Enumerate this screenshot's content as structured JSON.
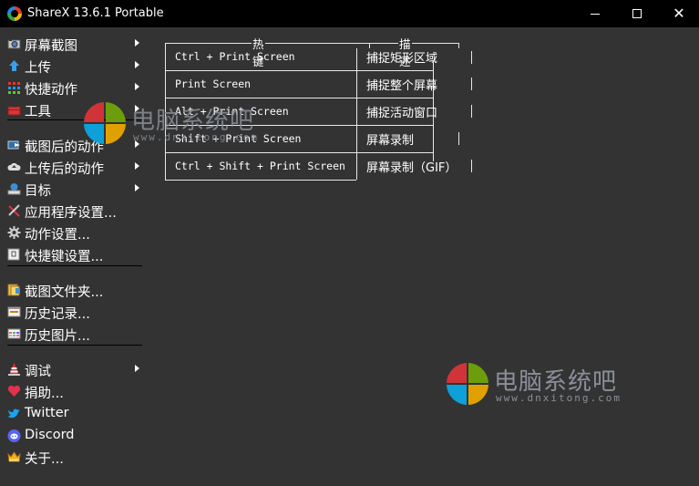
{
  "window": {
    "title": "ShareX 13.6.1 Portable",
    "minimize_icon": "minimize-icon",
    "maximize_icon": "maximize-icon",
    "close_icon": "close-icon"
  },
  "menu": {
    "items": [
      {
        "label": "屏幕截图",
        "icon": "camera-icon",
        "submenu": true
      },
      {
        "label": "上传",
        "icon": "upload-arrow-icon",
        "submenu": true
      },
      {
        "label": "快捷动作",
        "icon": "grid-dots-icon",
        "submenu": true
      },
      {
        "label": "工具",
        "icon": "toolbox-icon",
        "submenu": true
      },
      {
        "label": "截图后的动作",
        "icon": "after-capture-icon",
        "submenu": true
      },
      {
        "label": "上传后的动作",
        "icon": "cloud-upload-icon",
        "submenu": true
      },
      {
        "label": "目标",
        "icon": "destination-icon",
        "submenu": true
      },
      {
        "label": "应用程序设置...",
        "icon": "tools-icon",
        "submenu": false
      },
      {
        "label": "动作设置...",
        "icon": "gear-icon",
        "submenu": false
      },
      {
        "label": "快捷键设置...",
        "icon": "keyboard-key-icon",
        "submenu": false
      },
      {
        "label": "截图文件夹...",
        "icon": "folder-icon",
        "submenu": false
      },
      {
        "label": "历史记录...",
        "icon": "history-icon",
        "submenu": false
      },
      {
        "label": "历史图片...",
        "icon": "image-history-icon",
        "submenu": false
      },
      {
        "label": "调试",
        "icon": "traffic-cone-icon",
        "submenu": true
      },
      {
        "label": "捐助...",
        "icon": "heart-icon",
        "submenu": false
      },
      {
        "label": "Twitter",
        "icon": "twitter-icon",
        "submenu": false
      },
      {
        "label": "Discord",
        "icon": "discord-icon",
        "submenu": false
      },
      {
        "label": "关于...",
        "icon": "crown-icon",
        "submenu": false
      }
    ]
  },
  "hotkeys": {
    "header_hotkey": "热键",
    "header_description": "描述",
    "rows": [
      {
        "hotkey": "Ctrl + Print Screen",
        "description": "捕捉矩形区域"
      },
      {
        "hotkey": "Print Screen",
        "description": "捕捉整个屏幕"
      },
      {
        "hotkey": "Alt + Print Screen",
        "description": "捕捉活动窗口"
      },
      {
        "hotkey": "Shift + Print Screen",
        "description": "屏幕录制"
      },
      {
        "hotkey": "Ctrl + Shift + Print Screen",
        "description": "屏幕录制（GIF）"
      }
    ]
  },
  "watermark": {
    "text": "电脑系统吧",
    "url": "www.dnxitong.com",
    "colors": {
      "red": "#d13438",
      "green": "#6b9e0a",
      "blue": "#0ea0d8",
      "yellow": "#e0a100"
    }
  }
}
